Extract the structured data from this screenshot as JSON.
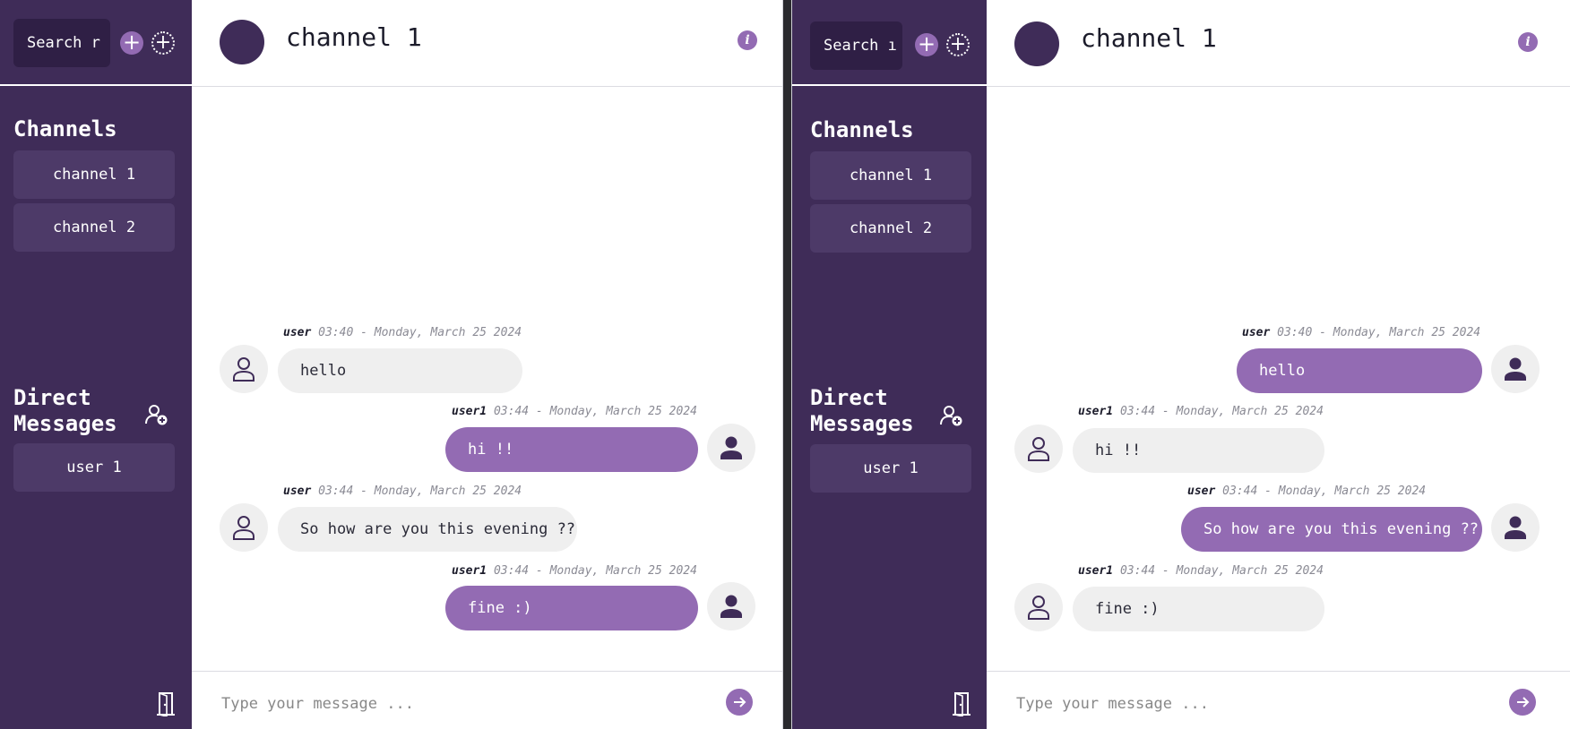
{
  "search": {
    "text_left": "Search r",
    "text_right": "Search ı"
  },
  "sidebar": {
    "channels_title": "Channels",
    "channels": [
      {
        "label": "channel 1"
      },
      {
        "label": "channel 2"
      }
    ],
    "dm_title_line1": "Direct",
    "dm_title_line2": "Messages",
    "dms": [
      {
        "label": "user 1"
      }
    ]
  },
  "header": {
    "title": "channel 1",
    "info_icon": "i"
  },
  "composer": {
    "placeholder": "Type your message ..."
  },
  "icons": {
    "plus": "+",
    "send": "send-arrow-icon",
    "logout": "door-icon",
    "add_user": "add-user-icon"
  },
  "colors": {
    "sidebar": "#3f2c58",
    "accent": "#936bb3",
    "bubble_in": "#efefef"
  },
  "left_window": {
    "messages": [
      {
        "user": "user",
        "time": "03:40 - Monday, March 25 2024",
        "text": "hello"
      },
      {
        "user": "user1",
        "time": "03:44 - Monday, March 25 2024",
        "text": "hi !!"
      },
      {
        "user": "user",
        "time": "03:44 - Monday, March 25 2024",
        "text": "So how are you this evening ??"
      },
      {
        "user": "user1",
        "time": "03:44 - Monday, March 25 2024",
        "text": "fine :)"
      }
    ]
  },
  "right_window": {
    "messages": [
      {
        "user": "user",
        "time": "03:40 - Monday, March 25 2024",
        "text": "hello"
      },
      {
        "user": "user1",
        "time": "03:44 - Monday, March 25 2024",
        "text": "hi !!"
      },
      {
        "user": "user",
        "time": "03:44 - Monday, March 25 2024",
        "text": "So how are you this evening ??"
      },
      {
        "user": "user1",
        "time": "03:44 - Monday, March 25 2024",
        "text": "fine :)"
      }
    ]
  }
}
